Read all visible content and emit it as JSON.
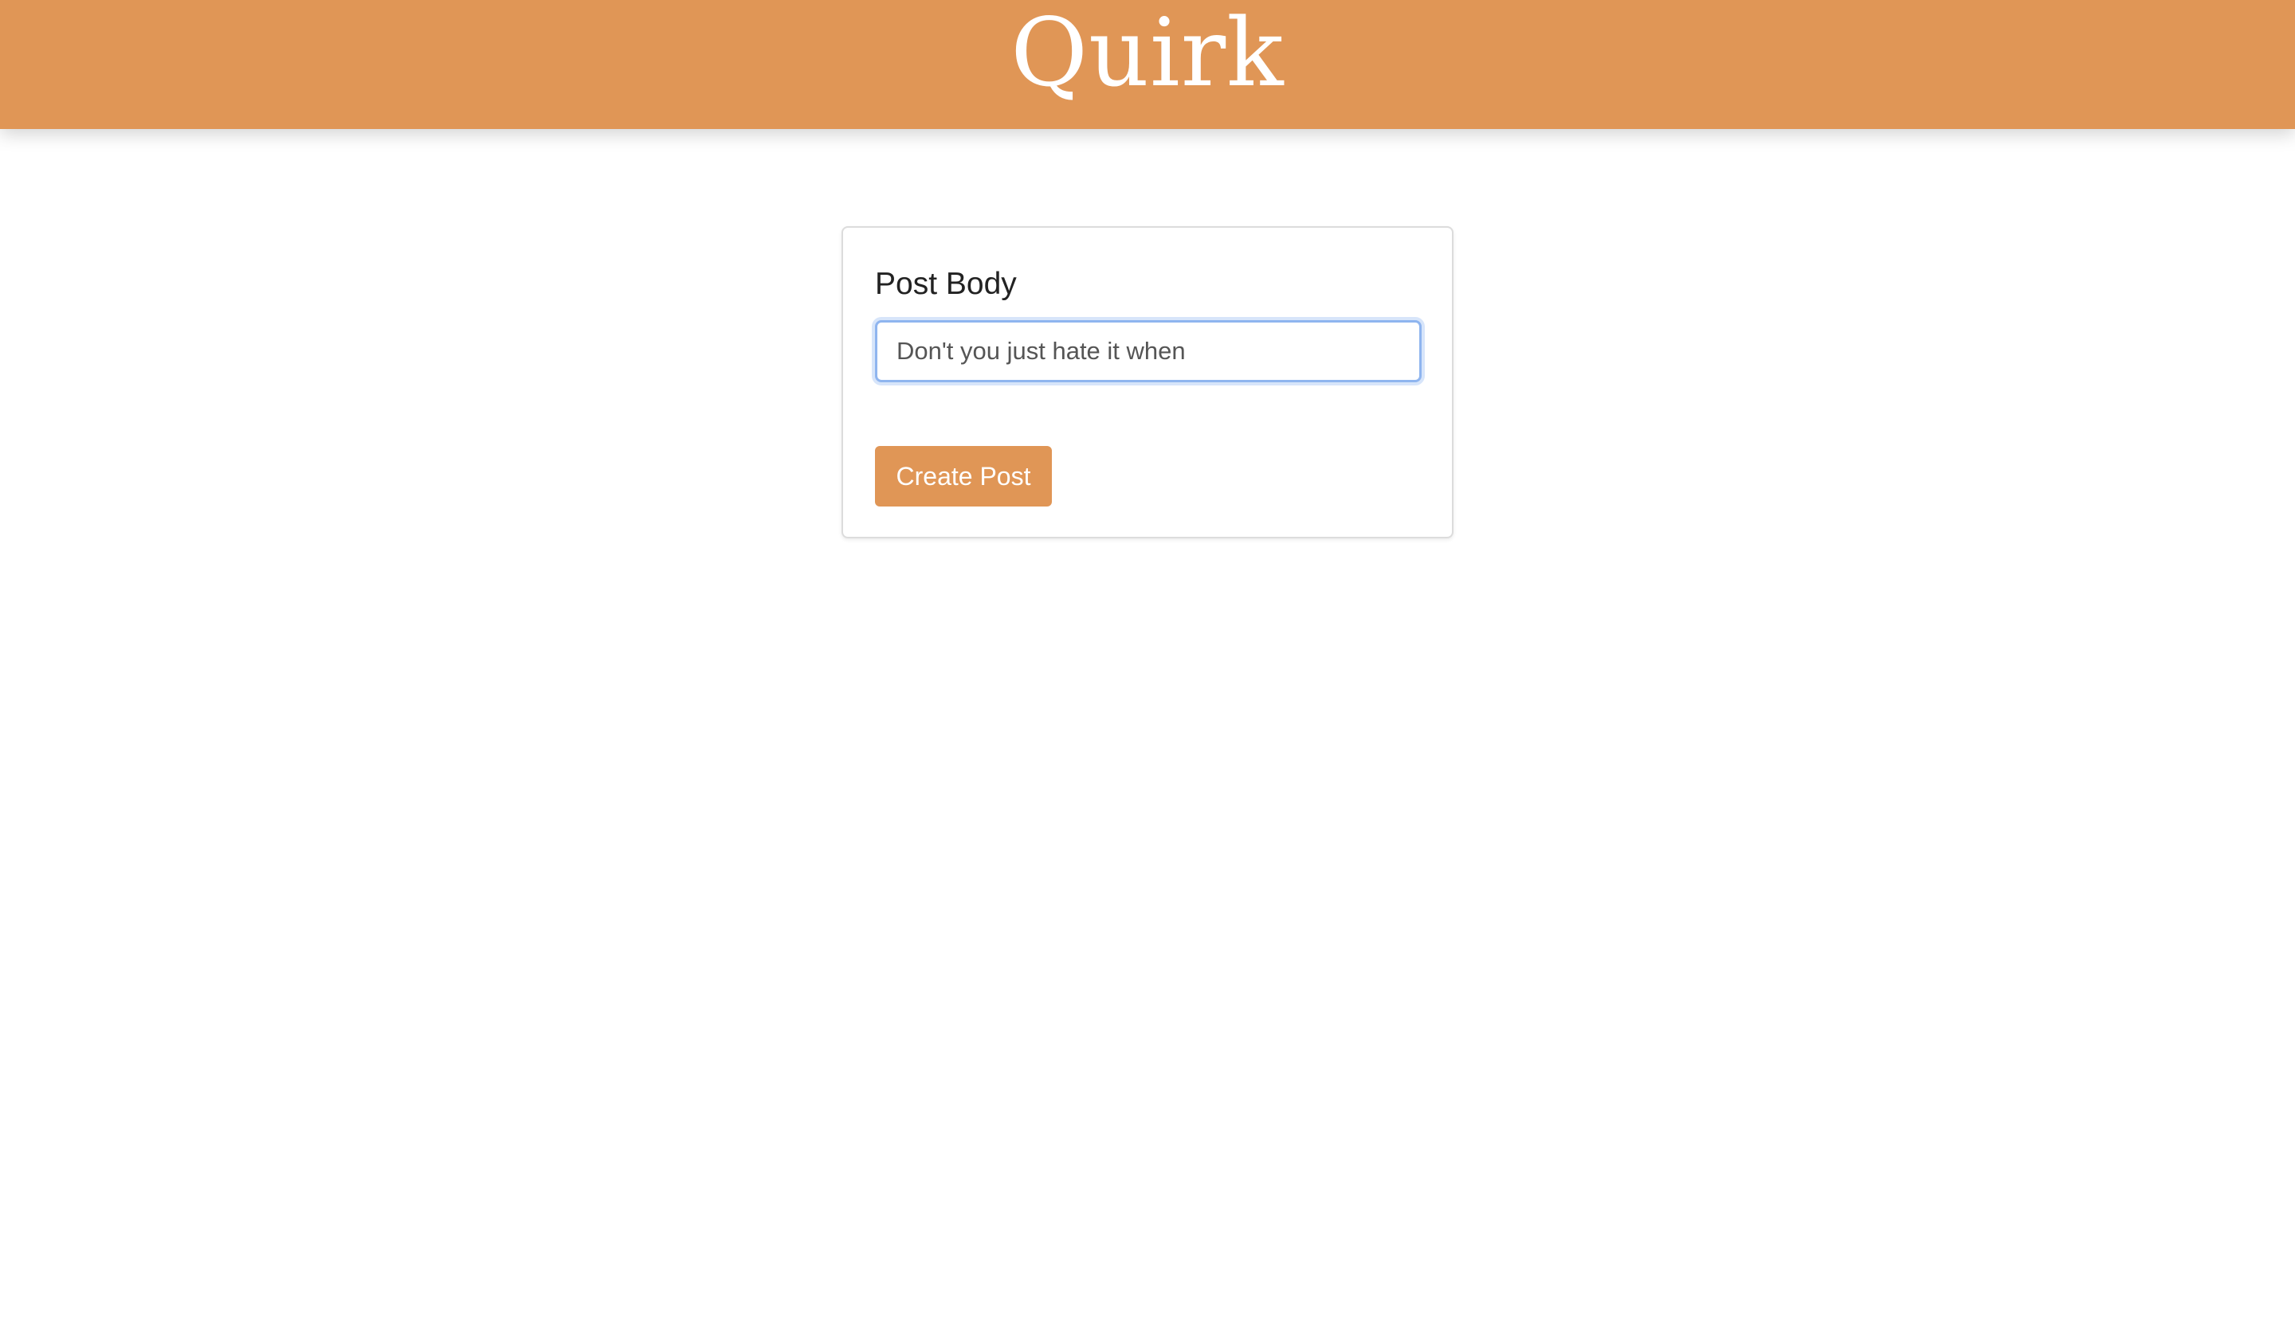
{
  "app": {
    "title": "Quirk"
  },
  "form": {
    "label": "Post Body",
    "input_value": "Don't you just hate it when",
    "submit_label": "Create Post"
  },
  "colors": {
    "brand": "#e09656",
    "focus_ring": "#8fb5ef"
  }
}
